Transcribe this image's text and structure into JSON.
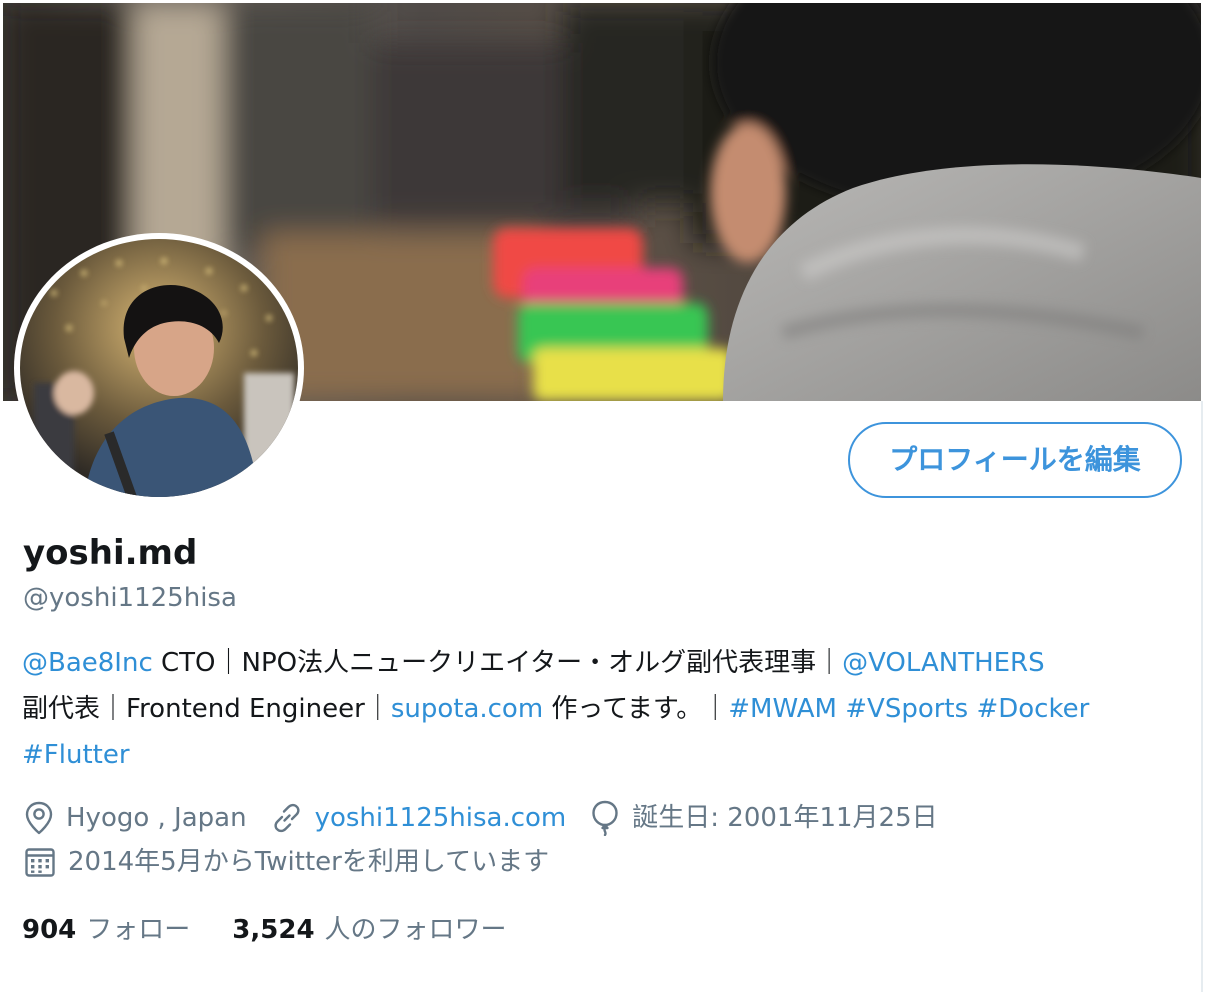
{
  "profile": {
    "display_name": "yoshi.md",
    "handle": "@yoshi1125hisa",
    "edit_button_label": "プロフィールを編集"
  },
  "bio": {
    "line1": {
      "mention_company": "@Bae8Inc",
      "text_a": " CTO｜NPO法人ニュークリエイター・オルグ副代表理事｜",
      "mention_org": "@VOLANTHERS"
    },
    "line2": {
      "text_a": "副代表｜Frontend Engineer｜",
      "link_site": "supota.com",
      "text_b": " 作ってます。｜",
      "hashtag_1": "#MWAM",
      "hashtag_2": "#VSports",
      "hashtag_3": "#Docker"
    },
    "line3": {
      "hashtag_4": "#Flutter"
    }
  },
  "meta": {
    "location": "Hyogo , Japan",
    "website": "yoshi1125hisa.com",
    "birthday": "誕生日: 2001年11月25日",
    "joined": "2014年5月からTwitterを利用しています"
  },
  "stats": {
    "following_count": "904",
    "following_label": "フォロー",
    "followers_count": "3,524",
    "followers_label": "人のフォロワー"
  },
  "icons": {
    "location": "location-pin-icon",
    "website": "link-icon",
    "birthday": "balloon-icon",
    "joined": "calendar-icon"
  },
  "colors": {
    "accent": "#2f8fd6",
    "button_border": "#3d94dc",
    "secondary_text": "#657786",
    "primary_text": "#14171a"
  }
}
